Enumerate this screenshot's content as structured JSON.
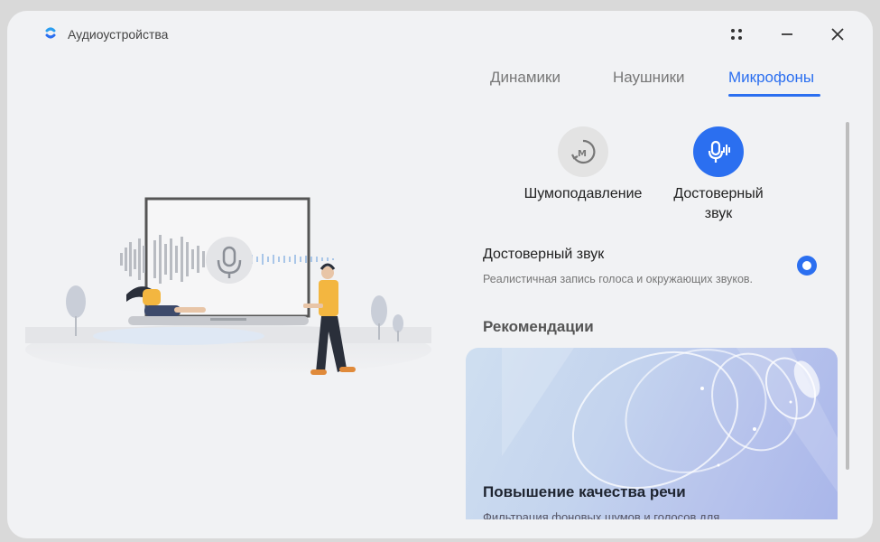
{
  "window": {
    "title": "Аудиоустройства"
  },
  "tabs": [
    {
      "label": "Динамики"
    },
    {
      "label": "Наушники"
    },
    {
      "label": "Микрофоны"
    }
  ],
  "active_tab": "Микрофоны",
  "modes": [
    {
      "label": "Шумоподавление",
      "icon": "noise-reduction-icon",
      "selected": false
    },
    {
      "label": "Достоверный звук",
      "icon": "microphone-sound-icon",
      "selected": true
    }
  ],
  "setting": {
    "title": "Достоверный звук",
    "description": "Реалистичная запись голоса и окружающих звуков.",
    "selected": true
  },
  "recommendations": {
    "heading": "Рекомендации",
    "card": {
      "title": "Повышение качества речи",
      "subtitle": "Фильтрация фоновых шумов и голосов для"
    }
  },
  "colors": {
    "accent": "#2b6ff0",
    "background": "#f1f2f4"
  }
}
